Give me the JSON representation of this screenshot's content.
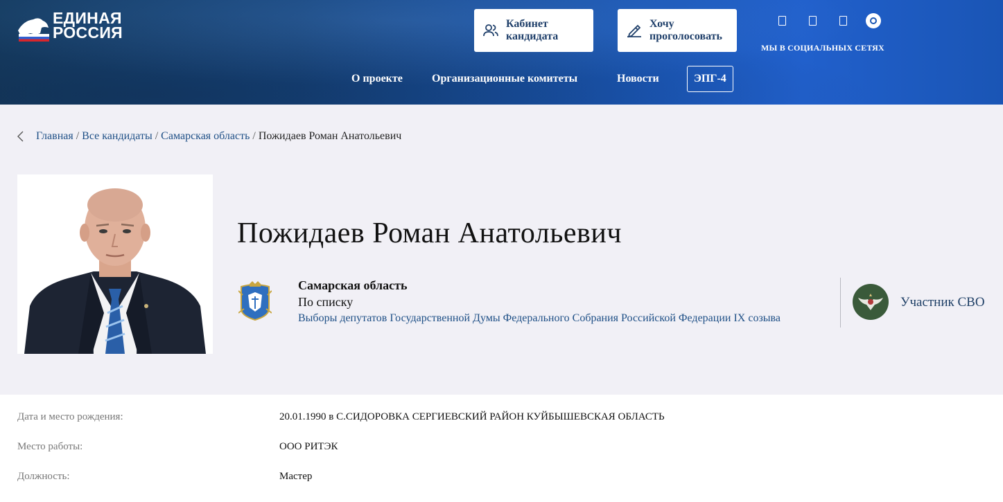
{
  "header": {
    "logo_line1": "ЕДИНАЯ",
    "logo_line2": "РОССИЯ",
    "cabinet_label": "Кабинет\nкандидата",
    "vote_label": "Хочу\nпроголосовать",
    "social_label": "МЫ В СОЦИАЛЬНЫХ СЕТЯХ",
    "social_icons": [
      "vk-icon",
      "ok-icon",
      "telegram-icon",
      "max-icon"
    ],
    "nav": [
      "О проекте",
      "Организационные комитеты",
      "Новости",
      "ЭПГ-4"
    ]
  },
  "breadcrumb": {
    "home": "Главная",
    "all": "Все кандидаты",
    "region": "Самарская область",
    "current": "Пожидаев Роман Анатольевич",
    "sep": "/"
  },
  "candidate": {
    "name": "Пожидаев Роман Анатольевич",
    "region": "Самарская область",
    "list_type": "По списку",
    "election": "Выборы депутатов Государственной Думы Федерального Собрания Российской Федерации IX созыва",
    "badge": "Участник СВО"
  },
  "details": [
    {
      "label": "Дата и место рождения:",
      "value": "20.01.1990 в С.СИДОРОВКА СЕРГИЕВСКИЙ РАЙОН КУЙБЫШЕВСКАЯ ОБЛАСТЬ"
    },
    {
      "label": "Место работы:",
      "value": "ООО РИТЭК"
    },
    {
      "label": "Должность:",
      "value": "Мастер"
    }
  ],
  "colors": {
    "header_blue": "#1a56b3",
    "link": "#1e4f86",
    "band_bg": "#f1f0f6"
  }
}
